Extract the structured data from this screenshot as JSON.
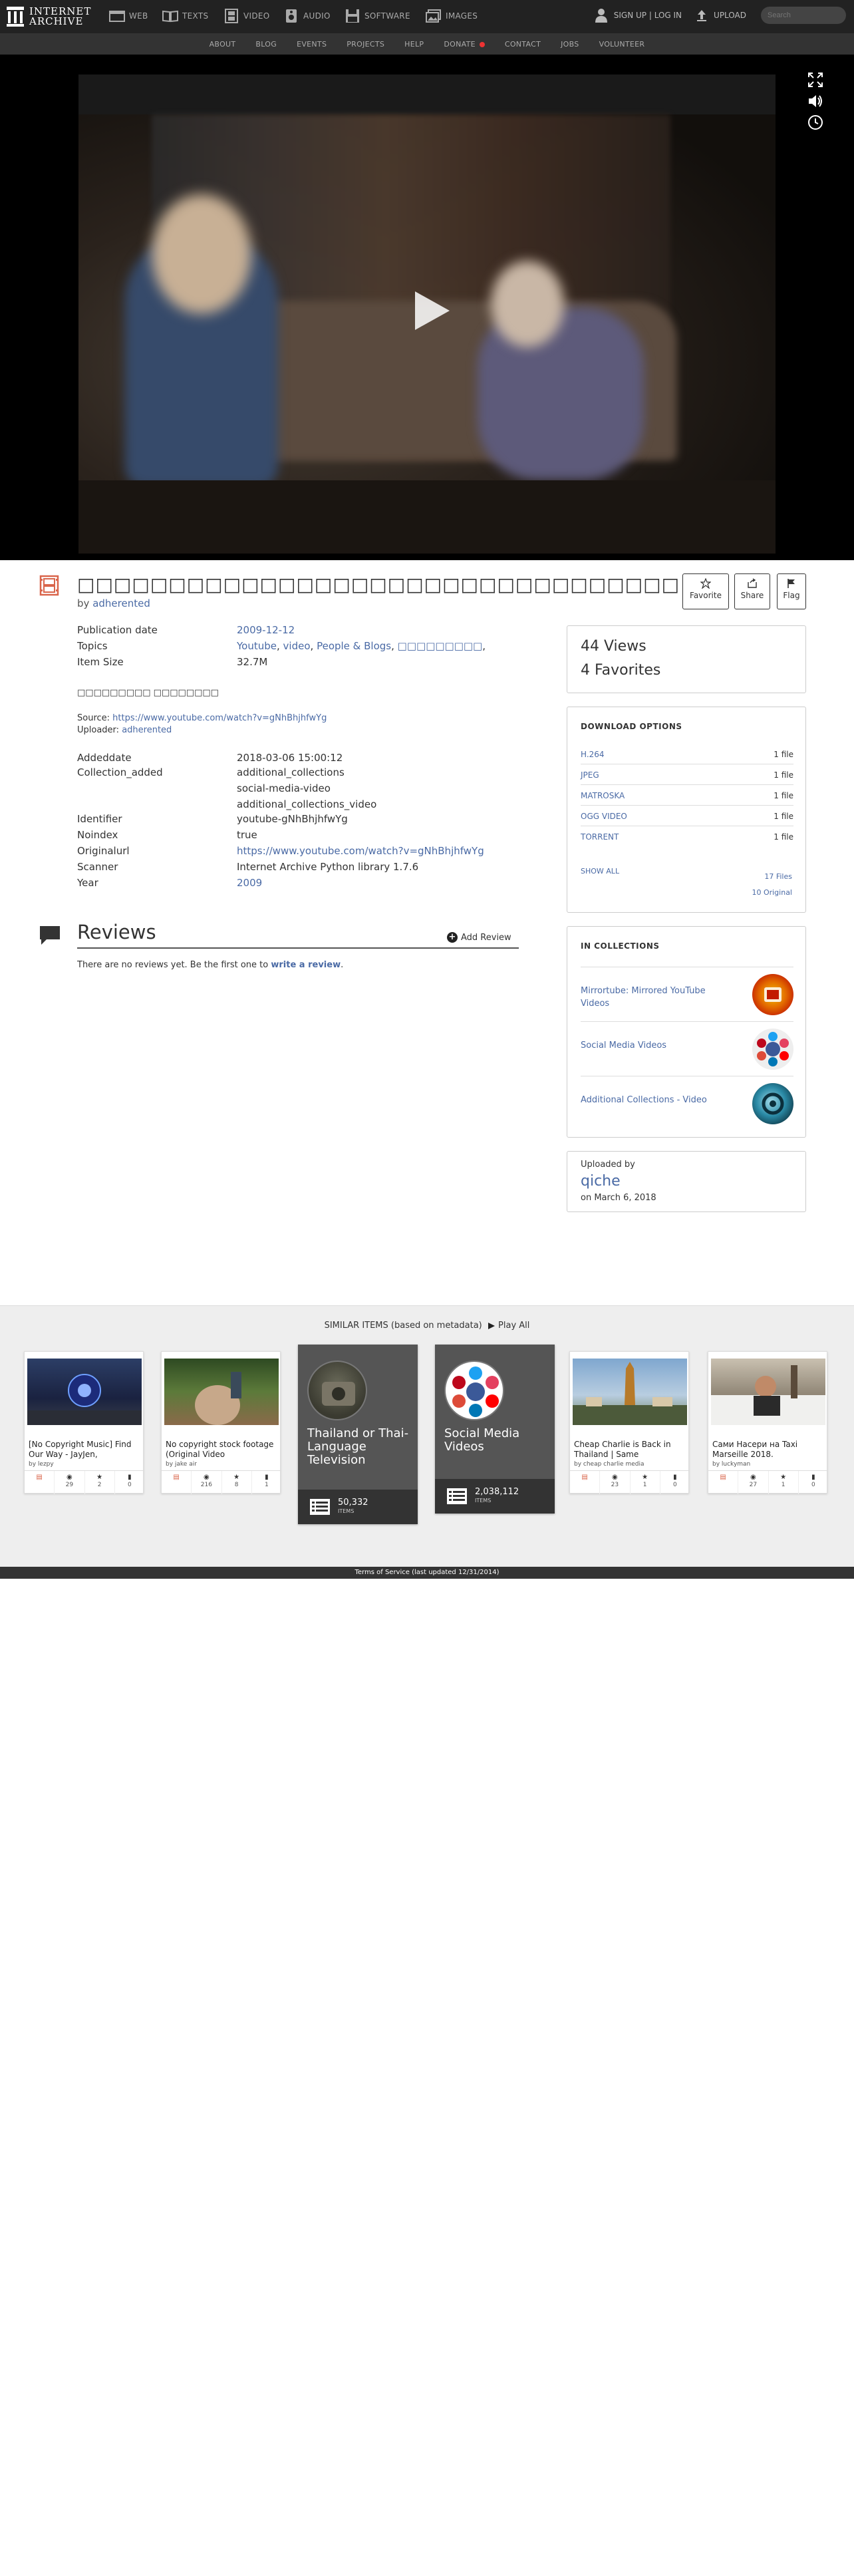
{
  "nav": {
    "logo_line1": "INTERNET",
    "logo_line2": "ARCHIVE",
    "media": [
      {
        "label": "WEB"
      },
      {
        "label": "TEXTS"
      },
      {
        "label": "VIDEO"
      },
      {
        "label": "AUDIO"
      },
      {
        "label": "SOFTWARE"
      },
      {
        "label": "IMAGES"
      }
    ],
    "signup": "SIGN UP | LOG IN",
    "upload": "UPLOAD",
    "search_placeholder": "Search"
  },
  "subnav": [
    "ABOUT",
    "BLOG",
    "EVENTS",
    "PROJECTS",
    "HELP",
    "DONATE",
    "CONTACT",
    "JOBS",
    "VOLUNTEER"
  ],
  "item": {
    "title": "□□□□□□□□□□□□□□□□□□□□□□□□□□□□□□□□□",
    "by_prefix": "by",
    "author": "adherented",
    "actions": {
      "favorite": "Favorite",
      "share": "Share",
      "flag": "Flag"
    }
  },
  "metadata": {
    "publication_date_label": "Publication date",
    "publication_date": "2009-12-12",
    "topics_label": "Topics",
    "topics": [
      "Youtube",
      "video",
      "People & Blogs",
      "□□□□□□□□□"
    ],
    "item_size_label": "Item Size",
    "item_size": "32.7M",
    "description": "□□□□□□□□□ □□□□□□□□",
    "source_label": "Source:",
    "source_url": "https://www.youtube.com/watch?v=gNhBhjhfwYg",
    "uploader_label": "Uploader:",
    "uploader": "adherented",
    "addeddate_label": "Addeddate",
    "addeddate": "2018-03-06 15:00:12",
    "collection_label": "Collection_added",
    "collections": [
      "additional_collections",
      "social-media-video",
      "additional_collections_video"
    ],
    "identifier_label": "Identifier",
    "identifier": "youtube-gNhBhjhfwYg",
    "noindex_label": "Noindex",
    "noindex": "true",
    "originalurl_label": "Originalurl",
    "originalurl": "https://www.youtube.com/watch?v=gNhBhjhfwYg",
    "scanner_label": "Scanner",
    "scanner": "Internet Archive Python library 1.7.6",
    "year_label": "Year",
    "year": "2009"
  },
  "reviews": {
    "title": "Reviews",
    "add": "Add Review",
    "empty_prefix": "There are no reviews yet. Be the first one to",
    "empty_link": "write a review",
    "empty_suffix": "."
  },
  "stats": {
    "views": "44 Views",
    "favorites": "4 Favorites"
  },
  "downloads": {
    "heading": "DOWNLOAD OPTIONS",
    "rows": [
      {
        "name": "H.264",
        "count": "1 file"
      },
      {
        "name": "JPEG",
        "count": "1 file"
      },
      {
        "name": "MATROSKA",
        "count": "1 file"
      },
      {
        "name": "OGG VIDEO",
        "count": "1 file"
      },
      {
        "name": "TORRENT",
        "count": "1 file"
      }
    ],
    "show_all": "SHOW ALL",
    "total_files": "17 Files",
    "original": "10 Original"
  },
  "in_collections": {
    "heading": "IN COLLECTIONS",
    "items": [
      {
        "name": "Mirrortube: Mirrored YouTube Videos"
      },
      {
        "name": "Social Media Videos"
      },
      {
        "name": "Additional Collections - Video"
      }
    ]
  },
  "uploaded": {
    "label": "Uploaded by",
    "name": "qiche",
    "date": "on March 6, 2018"
  },
  "similar": {
    "heading": "SIMILAR ITEMS (based on metadata)",
    "play_all": "Play All",
    "tiles": [
      {
        "title": "[No Copyright Music] Find Our Way - JayJen,",
        "by": "by lezpy",
        "views": "29",
        "favs": "2",
        "reviews": "0"
      },
      {
        "title": "No copyright stock footage (Original Video",
        "by": "by jake air",
        "views": "216",
        "favs": "8",
        "reviews": "1"
      },
      {
        "title": "Cheap Charlie is Back in Thailand | Same",
        "by": "by cheap charlie media",
        "views": "23",
        "favs": "1",
        "reviews": "0"
      },
      {
        "title": "Сами Насери на Taxi Marseille 2018.",
        "by": "by luckyman",
        "views": "27",
        "favs": "1",
        "reviews": "0"
      }
    ],
    "collections": [
      {
        "name": "Thailand or Thai-Language Television",
        "count": "50,332",
        "unit": "ITEMS"
      },
      {
        "name": "Social Media Videos",
        "count": "2,038,112",
        "unit": "ITEMS"
      }
    ]
  },
  "footer": "Terms of Service (last updated 12/31/2014)"
}
